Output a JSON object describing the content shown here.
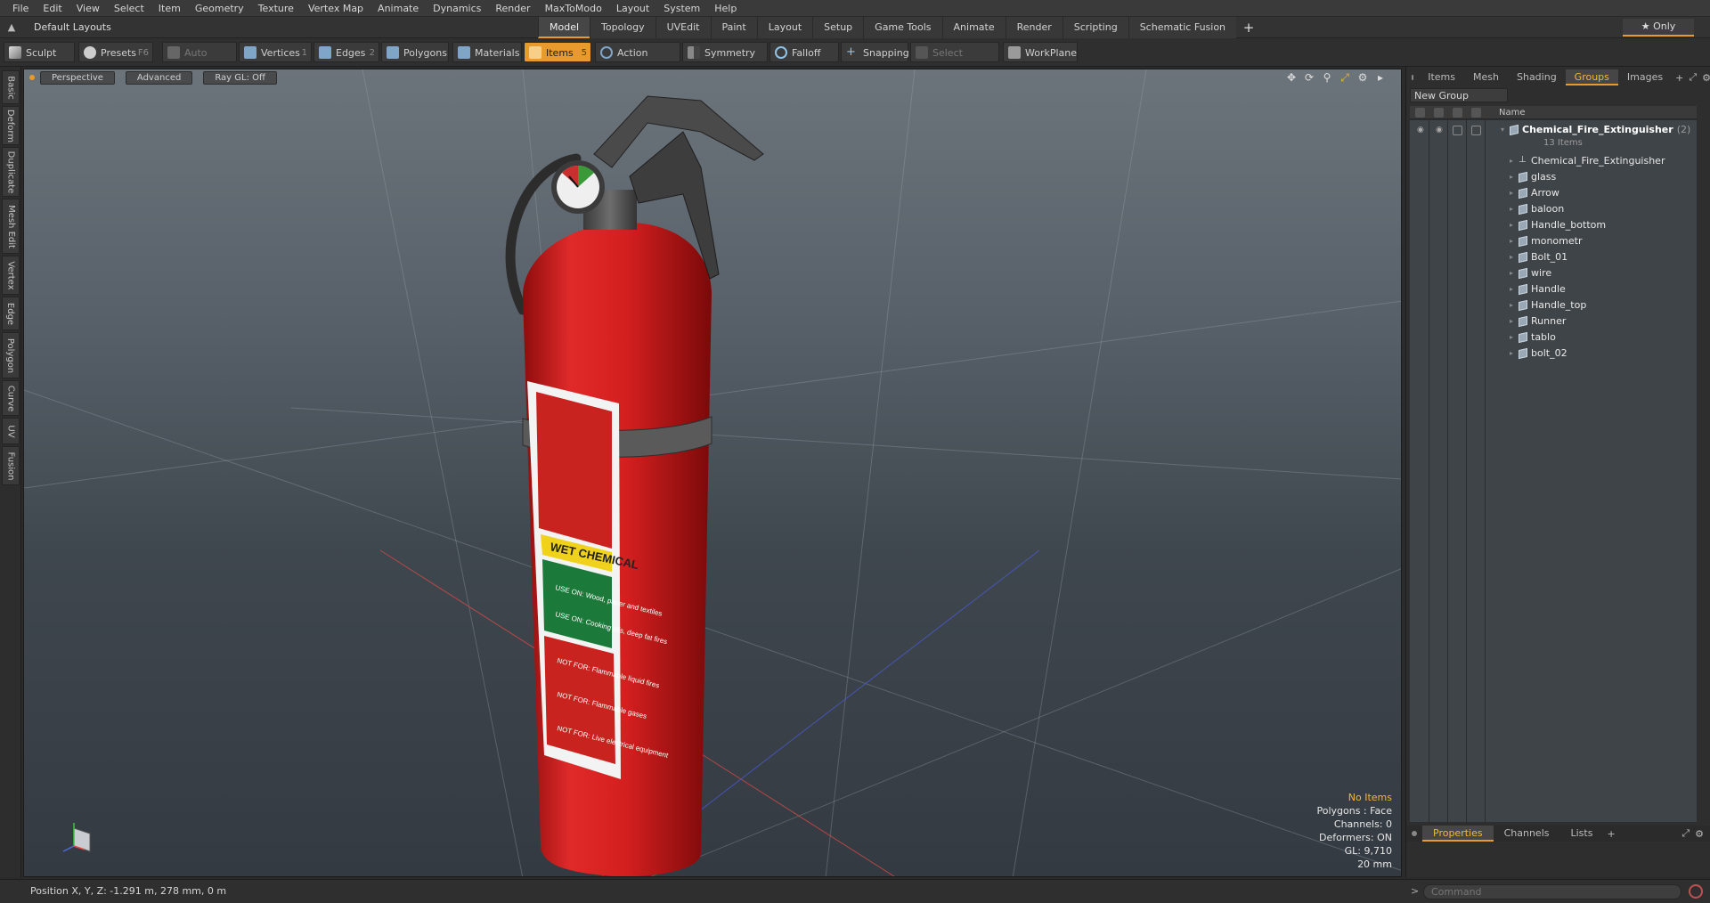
{
  "menu": [
    "File",
    "Edit",
    "View",
    "Select",
    "Item",
    "Geometry",
    "Texture",
    "Vertex Map",
    "Animate",
    "Dynamics",
    "Render",
    "MaxToModo",
    "Layout",
    "System",
    "Help"
  ],
  "layout_selector": "Default Layouts ▾",
  "tabs": [
    "Model",
    "Topology",
    "UVEdit",
    "Paint",
    "Layout",
    "Setup",
    "Game Tools",
    "Animate",
    "Render",
    "Scripting",
    "Schematic Fusion"
  ],
  "active_tab": "Model",
  "only_label": "★  Only",
  "toolbar": {
    "sculpt": "Sculpt",
    "presets": "Presets",
    "presets_key": "F6",
    "auto_select": "Auto Select",
    "vertices": "Vertices",
    "vertices_key": "1",
    "edges": "Edges",
    "edges_key": "2",
    "polygons": "Polygons",
    "materials": "Materials",
    "items": "Items",
    "items_key": "5",
    "action_center": "Action Center",
    "symmetry": "Symmetry",
    "falloff": "Falloff",
    "snapping": "Snapping",
    "select_through": "Select Through",
    "workplane": "WorkPlane"
  },
  "left_tabs": [
    "Basic",
    "Deform",
    "Duplicate",
    "Mesh Edit",
    "Vertex",
    "Edge",
    "Polygon",
    "Curve",
    "UV",
    "Fusion"
  ],
  "viewport": {
    "view": "Perspective",
    "shading": "Advanced",
    "raygl": "Ray GL: Off",
    "info": {
      "selection": "No Items",
      "polygons": "Polygons : Face",
      "channels": "Channels: 0",
      "deformers": "Deformers: ON",
      "gl": "GL: 9,710",
      "scale": "20 mm"
    },
    "label_texts": {
      "chemical": "WET CHEMICAL",
      "use1": "USE ON: Wood, paper and textiles",
      "use2": "USE ON: Cooking oils, deep fat fires",
      "not1": "NOT FOR: Flammable liquid fires",
      "not2": "NOT FOR: Flammable gases",
      "not3": "NOT FOR: Live electrical equipment"
    }
  },
  "right_panel": {
    "tabs": [
      "Items",
      "Mesh ...",
      "Shading",
      "Groups",
      "Images"
    ],
    "active_tab": "Groups",
    "new_group": "New Group",
    "column_name": "Name",
    "root": {
      "name": "Chemical_Fire_Extinguisher",
      "count": "(2)",
      "sub": "13 Items"
    },
    "items": [
      "Chemical_Fire_Extinguisher",
      "glass",
      "Arrow",
      "baloon",
      "Handle_bottom",
      "monometr",
      "Bolt_01",
      "wire",
      "Handle",
      "Handle_top",
      "Runner",
      "tablo",
      "bolt_02"
    ],
    "bottom_tabs": [
      "Properties",
      "Channels",
      "Lists"
    ],
    "bottom_active": "Properties"
  },
  "status": {
    "position": "Position X, Y, Z:  -1.291 m, 278 mm, 0 m",
    "command_placeholder": "Command"
  },
  "colors": {
    "accent": "#e89a2c",
    "extinguisher": "#d41f1f",
    "highlight_text": "#f1b83a"
  }
}
